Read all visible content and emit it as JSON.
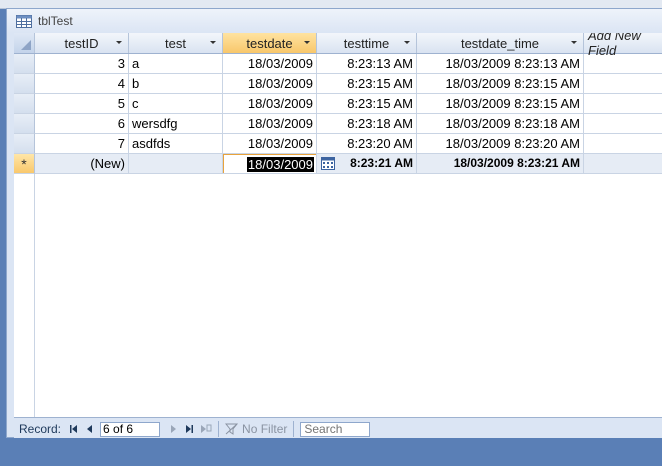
{
  "window": {
    "title": "tblTest"
  },
  "columns": [
    {
      "label": "testID"
    },
    {
      "label": "test"
    },
    {
      "label": "testdate"
    },
    {
      "label": "testtime"
    },
    {
      "label": "testdate_time"
    },
    {
      "label": "Add New Field"
    }
  ],
  "rows": [
    {
      "testID": "3",
      "test": "a",
      "testdate": "18/03/2009",
      "testtime": "8:23:13 AM",
      "testdate_time": "18/03/2009 8:23:13 AM"
    },
    {
      "testID": "4",
      "test": "b",
      "testdate": "18/03/2009",
      "testtime": "8:23:15 AM",
      "testdate_time": "18/03/2009 8:23:15 AM"
    },
    {
      "testID": "5",
      "test": "c",
      "testdate": "18/03/2009",
      "testtime": "8:23:15 AM",
      "testdate_time": "18/03/2009 8:23:15 AM"
    },
    {
      "testID": "6",
      "test": "wersdfg",
      "testdate": "18/03/2009",
      "testtime": "8:23:18 AM",
      "testdate_time": "18/03/2009 8:23:18 AM"
    },
    {
      "testID": "7",
      "test": "asdfds",
      "testdate": "18/03/2009",
      "testtime": "8:23:20 AM",
      "testdate_time": "18/03/2009 8:23:20 AM"
    }
  ],
  "new_row": {
    "marker": "*",
    "testID": "(New)",
    "test": "",
    "testdate": "18/03/2009",
    "testtime": "8:23:21 AM",
    "testdate_time": "18/03/2009 8:23:21 AM"
  },
  "status": {
    "record_label": "Record:",
    "record_position": "6 of 6",
    "filter_label": "No Filter",
    "search_placeholder": "Search"
  },
  "colors": {
    "active_header": "#f8c76b",
    "grid_lines": "#c9d4e4",
    "frame": "#dbe5f4"
  },
  "icons": [
    "table-icon",
    "dropdown-arrow-icon",
    "calendar-icon",
    "first-record-icon",
    "prev-record-icon",
    "next-record-icon",
    "last-record-icon",
    "new-record-icon",
    "filter-icon"
  ]
}
